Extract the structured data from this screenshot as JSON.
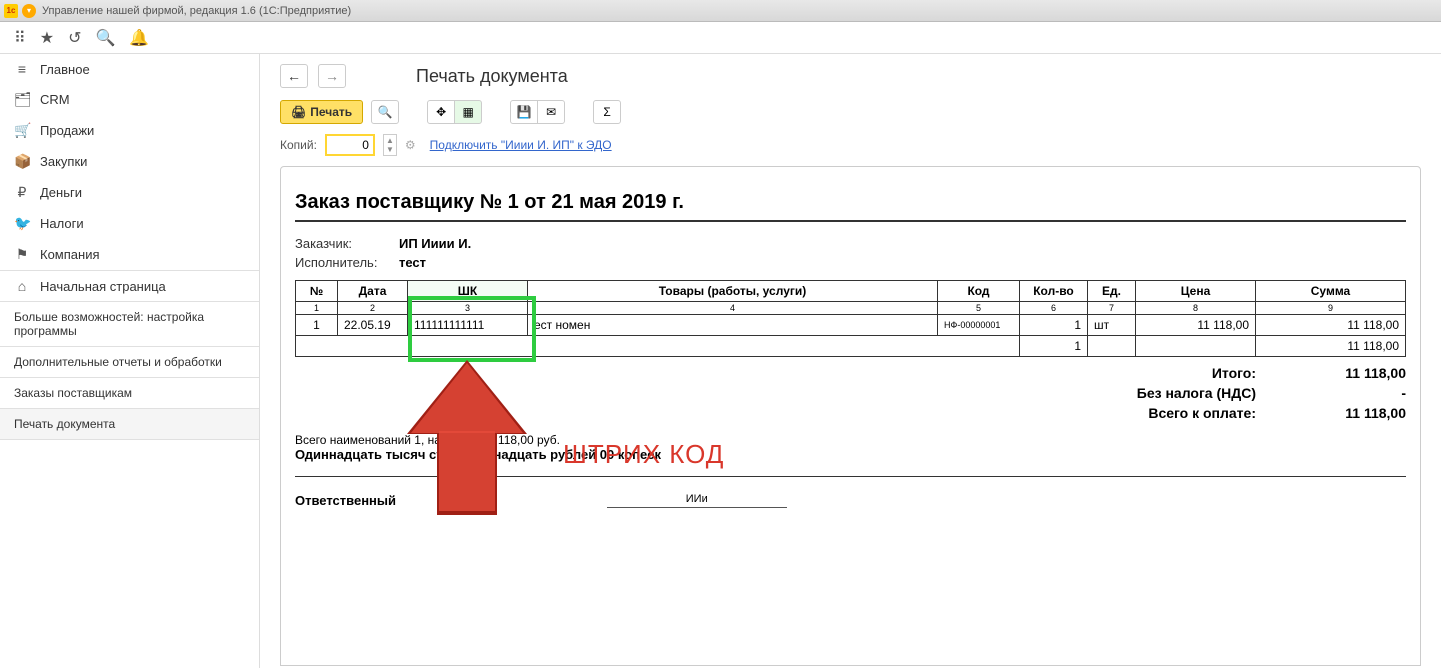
{
  "window": {
    "title": "Управление нашей фирмой, редакция 1.6  (1С:Предприятие)"
  },
  "sidebar": {
    "items": [
      {
        "icon": "≡",
        "label": "Главное"
      },
      {
        "icon": "🗂",
        "label": "CRM"
      },
      {
        "icon": "🛒",
        "label": "Продажи"
      },
      {
        "icon": "📦",
        "label": "Закупки"
      },
      {
        "icon": "₽",
        "label": "Деньги"
      },
      {
        "icon": "🐦",
        "label": "Налоги"
      },
      {
        "icon": "⚑",
        "label": "Компания"
      }
    ],
    "subitems": [
      {
        "icon": "⌂",
        "label": "Начальная страница"
      },
      {
        "label": "Больше возможностей: настройка программы"
      },
      {
        "label": "Дополнительные отчеты и обработки"
      },
      {
        "label": "Заказы поставщикам"
      },
      {
        "label": "Печать документа"
      }
    ]
  },
  "header": {
    "page_title": "Печать документа",
    "print_btn": "Печать",
    "copies_label": "Копий:",
    "copies_value": "0",
    "edo_link": "Подключить \"Ииии И. ИП\" к ЭДО"
  },
  "document": {
    "title": "Заказ поставщику № 1 от 21 мая 2019 г.",
    "customer_label": "Заказчик:",
    "customer_value": "ИП Ииии И.",
    "executor_label": "Исполнитель:",
    "executor_value": "тест",
    "table": {
      "headers": [
        "№",
        "Дата",
        "ШК",
        "Товары (работы, услуги)",
        "Код",
        "Кол-во",
        "Ед.",
        "Цена",
        "Сумма"
      ],
      "numbers": [
        "1",
        "2",
        "3",
        "4",
        "5",
        "6",
        "7",
        "8",
        "9"
      ],
      "row": {
        "num": "1",
        "date": "22.05.19",
        "shk": "111111111111",
        "goods": "ест номен",
        "code": "НФ-00000001",
        "qty": "1",
        "unit": "шт",
        "price": "11 118,00",
        "sum": "11 118,00"
      },
      "footer_qty": "1",
      "footer_sum": "11 118,00"
    },
    "totals": {
      "total_label": "Итого:",
      "total_value": "11 118,00",
      "novat_label": "Без налога (НДС)",
      "novat_value": "-",
      "grand_label": "Всего к оплате:",
      "grand_value": "11 118,00"
    },
    "summary1": "Всего наименований 1, на сумму 11 118,00 руб.",
    "summary2": "Одиннадцать тысяч сто восемнадцать рублей 00 копеек",
    "responsible_label": "Ответственный",
    "responsible_value": "ИИи"
  },
  "annotation": {
    "text": "ШТРИХ КОД"
  }
}
